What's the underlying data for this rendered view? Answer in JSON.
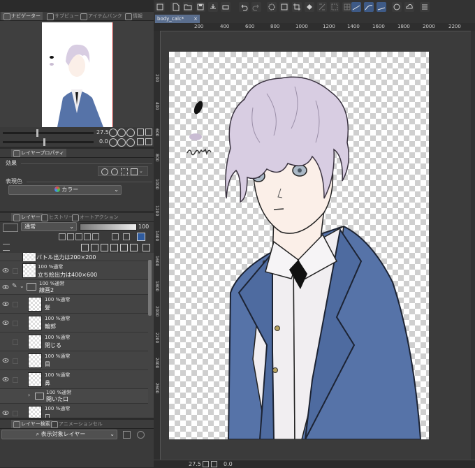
{
  "navigator": {
    "tabs": [
      "ナビゲーター",
      "サブビュー",
      "アイテムバンク",
      "情報"
    ],
    "zoom": "27.5",
    "rotation": "0.0"
  },
  "properties": {
    "tab": "レイヤープロパティ",
    "effect_label": "効果",
    "color_label": "表現色",
    "color_value": "カラー"
  },
  "layers_panel": {
    "tabs": [
      "レイヤー",
      "ヒストリー",
      "オートアクション"
    ],
    "blend_mode": "通常",
    "opacity": "100",
    "layers": [
      {
        "line1": "",
        "line2": "バトル出力は200×200"
      },
      {
        "line1": "100 %通常",
        "line2": "立ち絵出力は400×600"
      },
      {
        "line1": "100 %通常",
        "line2": "線画2"
      },
      {
        "line1": "100 %通常",
        "line2": "髪"
      },
      {
        "line1": "100 %通常",
        "line2": "輪郭"
      },
      {
        "line1": "100 %通常",
        "line2": "閉じる"
      },
      {
        "line1": "100 %通常",
        "line2": "目"
      },
      {
        "line1": "100 %通常",
        "line2": "鼻"
      },
      {
        "line1": "100 %通常",
        "line2": "開いた口"
      },
      {
        "line1": "100 %通常",
        "line2": "口"
      }
    ]
  },
  "layer_search": {
    "tabs": [
      "レイヤー検索",
      "アニメーションセル"
    ],
    "dropdown": "表示対象レイヤー"
  },
  "document": {
    "tab_title": "body_calc*",
    "ruler_top": [
      "200",
      "400",
      "600",
      "800",
      "1000",
      "1200",
      "1400",
      "1600",
      "1800",
      "2000",
      "2200"
    ],
    "ruler_left": [
      "200",
      "400",
      "600",
      "800",
      "1000",
      "1200",
      "1400",
      "1600",
      "1800",
      "2000",
      "2200",
      "2400",
      "2600"
    ],
    "status_zoom": "27.5",
    "status_rotation": "0.0"
  },
  "colors": {
    "background": "#2b2b2b",
    "panel": "#3a3a3a",
    "accent": "#2f5b9e",
    "suit": "#5673a8",
    "hair": "#d8cde2"
  }
}
